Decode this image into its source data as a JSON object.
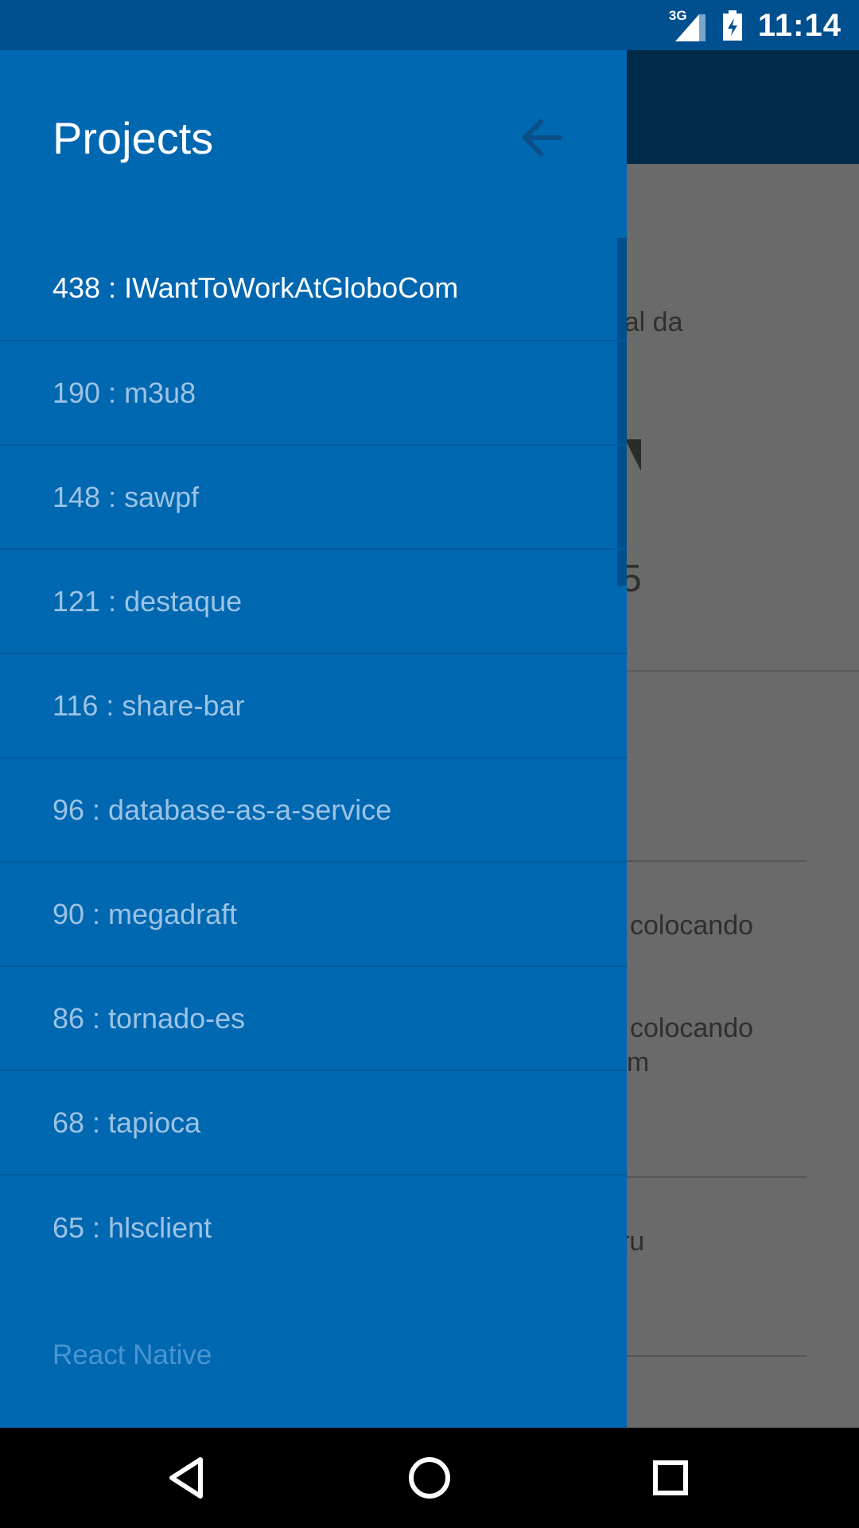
{
  "status_bar": {
    "network": "3G",
    "time": "11:14"
  },
  "drawer": {
    "title": "Projects",
    "items": [
      {
        "label": "438 : IWantToWorkAtGloboCom",
        "active": true
      },
      {
        "label": "190 : m3u8"
      },
      {
        "label": "148 : sawpf"
      },
      {
        "label": "121 : destaque"
      },
      {
        "label": "116 : share-bar"
      },
      {
        "label": "96 : database-as-a-service"
      },
      {
        "label": "90 : megadraft"
      },
      {
        "label": "86 : tornado-es"
      },
      {
        "label": "68 : tapioca"
      },
      {
        "label": "65 : hlsclient"
      }
    ],
    "section_label": "React Native"
  },
  "background": {
    "text_1": "rtal da",
    "text_2": "5",
    "text_3": "colocando",
    "text_4a": "colocando",
    "text_4b": "m",
    "text_5": "ru"
  },
  "colors": {
    "drawer_bg": "#0067b1",
    "status_bar_bg": "#004f8e",
    "app_bar_bg": "#002a4a"
  },
  "icons": {
    "back": "arrow-left-icon",
    "nav_back": "triangle-back-icon",
    "nav_home": "circle-home-icon",
    "nav_recents": "square-recents-icon"
  }
}
